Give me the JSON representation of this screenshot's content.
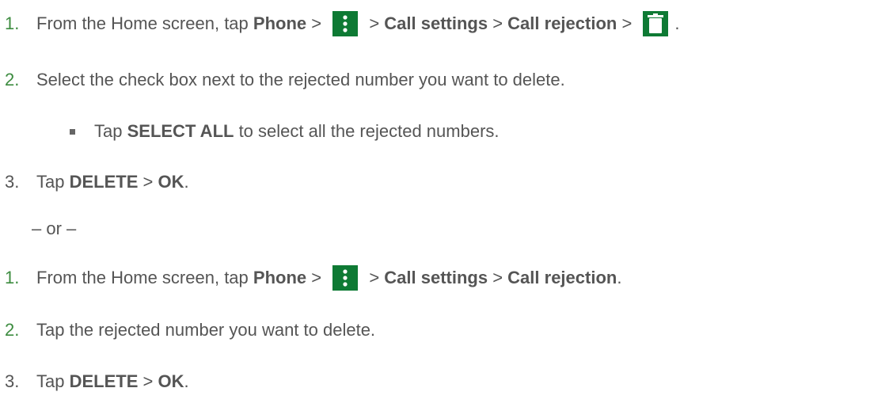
{
  "section1": {
    "step1": {
      "num": "1.",
      "pre": "From the Home screen, tap ",
      "b1": "Phone",
      "s1": " > ",
      "s2": " > ",
      "b2": "Call settings",
      "s3": " > ",
      "b3": "Call rejection",
      "s4": " > ",
      "end": "."
    },
    "step2": {
      "num": "2.",
      "text": "Select the check box next to the rejected number you want to delete."
    },
    "bullet": {
      "pre": "Tap ",
      "b1": "SELECT ALL",
      "post": " to select all the rejected numbers."
    },
    "step3": {
      "num": "3.",
      "pre": "Tap ",
      "b1": "DELETE",
      "s1": " > ",
      "b2": "OK",
      "end": "."
    }
  },
  "or_text": "– or –",
  "section2": {
    "step1": {
      "num": "1.",
      "pre": "From the Home screen, tap ",
      "b1": "Phone",
      "s1": " > ",
      "s2": " > ",
      "b2": "Call settings",
      "s3": " > ",
      "b3": "Call rejection",
      "end": "."
    },
    "step2": {
      "num": "2.",
      "text": "Tap the rejected number you want to delete."
    },
    "step3": {
      "num": "3.",
      "pre": "Tap ",
      "b1": "DELETE",
      "s1": " > ",
      "b2": "OK",
      "end": "."
    }
  },
  "icons": {
    "menu": "more-vert-icon",
    "trash": "trash-icon",
    "icon_bg": "#0e7a34"
  },
  "colors": {
    "text": "#555555",
    "step_number_green": "#3d8c40"
  }
}
